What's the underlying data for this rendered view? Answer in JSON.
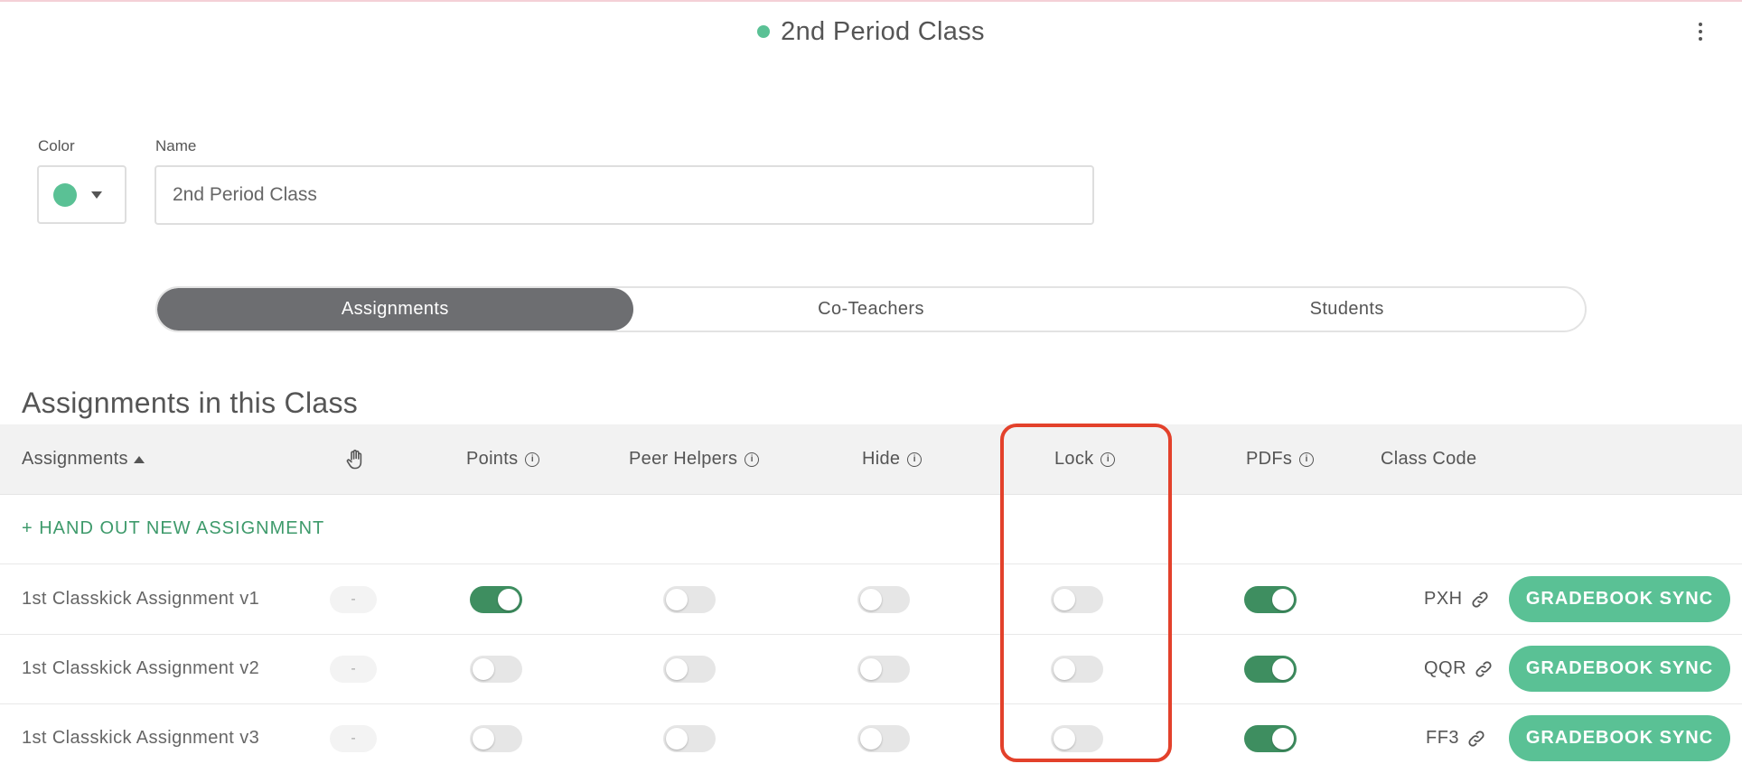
{
  "header": {
    "title": "2nd Period Class",
    "accent_color": "#5ac195"
  },
  "form": {
    "color_label": "Color",
    "name_label": "Name",
    "name_value": "2nd Period Class",
    "selected_color": "#5ac195"
  },
  "tabs": [
    {
      "label": "Assignments",
      "active": true
    },
    {
      "label": "Co-Teachers",
      "active": false
    },
    {
      "label": "Students",
      "active": false
    }
  ],
  "section_title": "Assignments in this Class",
  "table": {
    "columns": {
      "assignments": "Assignments",
      "points": "Points",
      "peer_helpers": "Peer Helpers",
      "hide": "Hide",
      "lock": "Lock",
      "pdfs": "PDFs",
      "class_code": "Class Code"
    },
    "hand_out_label": "+ HAND OUT NEW ASSIGNMENT",
    "rows": [
      {
        "name": "1st Classkick Assignment v1",
        "folder": "-",
        "points": true,
        "peer_helpers": false,
        "hide": false,
        "lock": false,
        "pdfs": true,
        "code": "PXH",
        "sync_label": "GRADEBOOK SYNC"
      },
      {
        "name": "1st Classkick Assignment v2",
        "folder": "-",
        "points": false,
        "peer_helpers": false,
        "hide": false,
        "lock": false,
        "pdfs": true,
        "code": "QQR",
        "sync_label": "GRADEBOOK SYNC"
      },
      {
        "name": "1st Classkick Assignment v3",
        "folder": "-",
        "points": false,
        "peer_helpers": false,
        "hide": false,
        "lock": false,
        "pdfs": true,
        "code": "FF3",
        "sync_label": "GRADEBOOK SYNC"
      }
    ]
  },
  "colors": {
    "toggle_on": "#3e8e60",
    "button": "#5ac195",
    "highlight": "#e3412b"
  },
  "icons": [
    "kebab-menu-icon",
    "chevron-down-icon",
    "sort-up-icon",
    "hand-icon",
    "info-icon",
    "link-icon"
  ]
}
